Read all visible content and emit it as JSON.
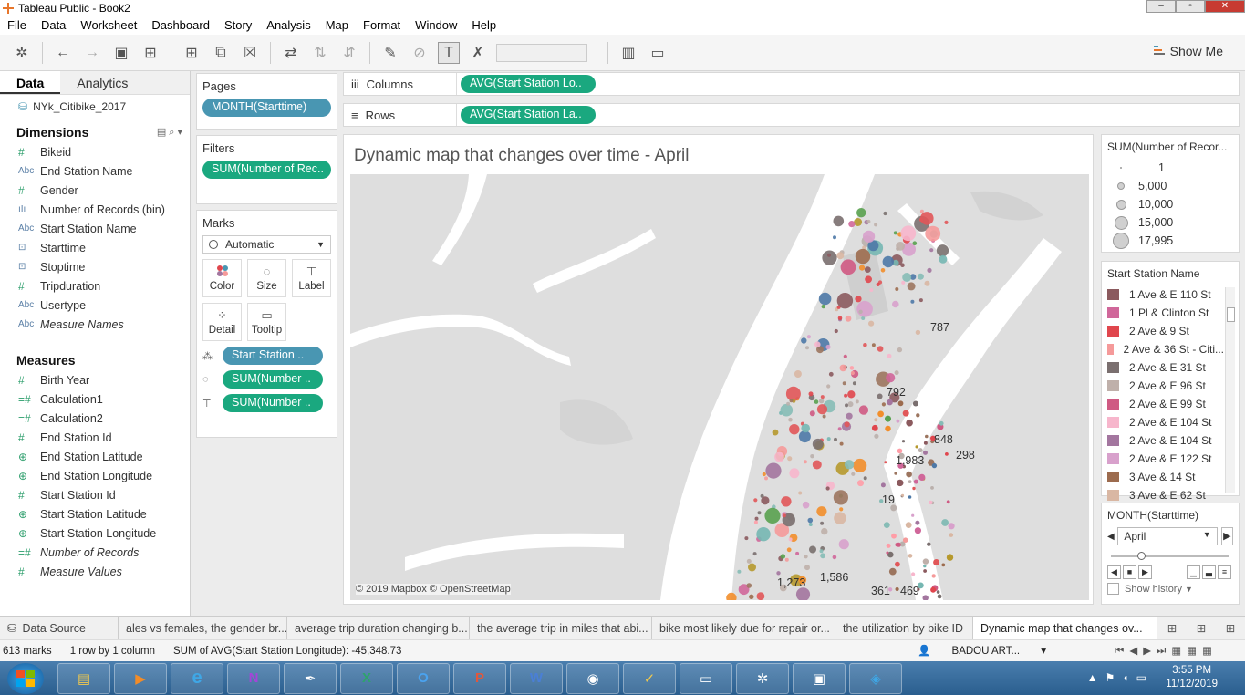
{
  "window": {
    "title": "Tableau Public - Book2"
  },
  "menu": [
    "File",
    "Data",
    "Worksheet",
    "Dashboard",
    "Story",
    "Analysis",
    "Map",
    "Format",
    "Window",
    "Help"
  ],
  "toolbar": {
    "show_me": "Show Me"
  },
  "datapane": {
    "tab_data": "Data",
    "tab_analytics": "Analytics",
    "datasource": "NYk_Citibike_2017",
    "dimensions_title": "Dimensions",
    "dimensions": [
      {
        "type": "#",
        "name": "Bikeid",
        "italic": false
      },
      {
        "type": "Abc",
        "name": "End Station Name",
        "italic": false
      },
      {
        "type": "#",
        "name": "Gender",
        "italic": false
      },
      {
        "type": "ıIı",
        "name": "Number of Records (bin)",
        "italic": false
      },
      {
        "type": "Abc",
        "name": "Start Station Name",
        "italic": false
      },
      {
        "type": "⊡",
        "name": "Starttime",
        "italic": false
      },
      {
        "type": "⊡",
        "name": "Stoptime",
        "italic": false
      },
      {
        "type": "#",
        "name": "Tripduration",
        "italic": false
      },
      {
        "type": "Abc",
        "name": "Usertype",
        "italic": false
      },
      {
        "type": "Abc",
        "name": "Measure Names",
        "italic": true
      }
    ],
    "measures_title": "Measures",
    "measures": [
      {
        "type": "#",
        "name": "Birth Year",
        "italic": false
      },
      {
        "type": "=#",
        "name": "Calculation1",
        "italic": false
      },
      {
        "type": "=#",
        "name": "Calculation2",
        "italic": false
      },
      {
        "type": "#",
        "name": "End Station Id",
        "italic": false
      },
      {
        "type": "⊕",
        "name": "End Station Latitude",
        "italic": false
      },
      {
        "type": "⊕",
        "name": "End Station Longitude",
        "italic": false
      },
      {
        "type": "#",
        "name": "Start Station Id",
        "italic": false
      },
      {
        "type": "⊕",
        "name": "Start Station Latitude",
        "italic": false
      },
      {
        "type": "⊕",
        "name": "Start Station Longitude",
        "italic": false
      },
      {
        "type": "=#",
        "name": "Number of Records",
        "italic": true
      },
      {
        "type": "#",
        "name": "Measure Values",
        "italic": true
      }
    ]
  },
  "shelves": {
    "pages_label": "Pages",
    "pages_pill": "MONTH(Starttime)",
    "filters_label": "Filters",
    "filters_pill": "SUM(Number of Rec..",
    "marks_label": "Marks",
    "marks_type": "Automatic",
    "mark_buttons": {
      "color": "Color",
      "size": "Size",
      "label": "Label",
      "detail": "Detail",
      "tooltip": "Tooltip"
    },
    "mark_pills": [
      "Start Station ..",
      "SUM(Number ..",
      "SUM(Number .."
    ],
    "columns_label": "Columns",
    "columns_pill": "AVG(Start Station Lo..",
    "rows_label": "Rows",
    "rows_pill": "AVG(Start Station La.."
  },
  "view": {
    "title": "Dynamic map that changes over time - April",
    "attribution": "© 2019 Mapbox © OpenStreetMap",
    "labels": [
      "787",
      "792",
      "848",
      "298",
      "1,983",
      "19",
      "1,273",
      "1,586",
      "361",
      "469"
    ]
  },
  "legend_size": {
    "title": "SUM(Number of Recor...",
    "items": [
      "1",
      "5,000",
      "10,000",
      "15,000",
      "17,995"
    ]
  },
  "legend_color": {
    "title": "Start Station Name",
    "items": [
      {
        "label": "1 Ave & E 110 St",
        "color": "#8b5a5e"
      },
      {
        "label": "1 Pl & Clinton St",
        "color": "#d0679a"
      },
      {
        "label": "2 Ave & 9 St",
        "color": "#e0464d"
      },
      {
        "label": "2 Ave & 36 St - Citi...",
        "color": "#f59a9a"
      },
      {
        "label": "2 Ave & E 31 St",
        "color": "#7a6f6f"
      },
      {
        "label": "2 Ave & E 96 St",
        "color": "#bfb0aa"
      },
      {
        "label": "2 Ave & E 99 St",
        "color": "#cf5a83"
      },
      {
        "label": "2 Ave  & E 104 St",
        "color": "#f7b6cc"
      },
      {
        "label": "2 Ave & E 104 St",
        "color": "#a3769f"
      },
      {
        "label": "2 Ave & E 122 St",
        "color": "#d8a1cc"
      },
      {
        "label": "3 Ave & 14 St",
        "color": "#9c6b4e"
      },
      {
        "label": "3 Ave & E 62 St",
        "color": "#d9b7a3"
      }
    ]
  },
  "page_control": {
    "title": "MONTH(Starttime)",
    "selected": "April",
    "show_history": "Show history"
  },
  "sheet_tabs": {
    "datasource": "Data Source",
    "tabs": [
      "ales vs females, the gender br...",
      "average trip duration changing b...",
      "the average trip in miles that abi...",
      "bike most likely due for repair or...",
      "the utilization by bike ID",
      "Dynamic map that changes ov..."
    ]
  },
  "status": {
    "marks": "613 marks",
    "rowscols": "1 row by 1 column",
    "sum": "SUM of AVG(Start Station Longitude): -45,348.73",
    "user": "BADOU ART..."
  },
  "taskbar": {
    "time": "3:55 PM",
    "date": "11/12/2019"
  },
  "colors": {
    "pill_blue": "#4996b2",
    "pill_green": "#1aa87f",
    "map_land": "#dedede",
    "map_water": "#ffffff"
  }
}
